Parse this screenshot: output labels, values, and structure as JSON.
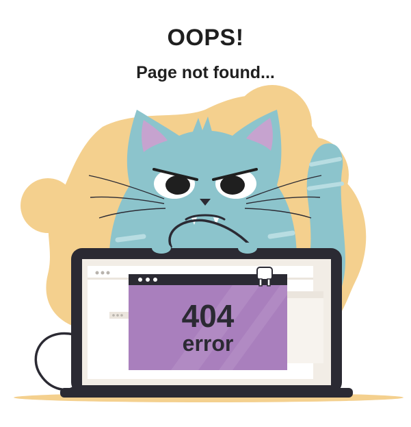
{
  "heading": {
    "title": "OOPS!",
    "subtitle": "Page not found..."
  },
  "screen": {
    "code": "404",
    "label": "error"
  },
  "colors": {
    "background": "#ffffff",
    "blob": "#f4d08e",
    "cat": "#8cc4cc",
    "laptop": "#2b2a33",
    "screen": "#f2ede6",
    "error_window": "#a97fbd"
  },
  "icons": [
    "cat-illustration",
    "laptop-icon",
    "power-plug-icon",
    "cable-icon"
  ]
}
